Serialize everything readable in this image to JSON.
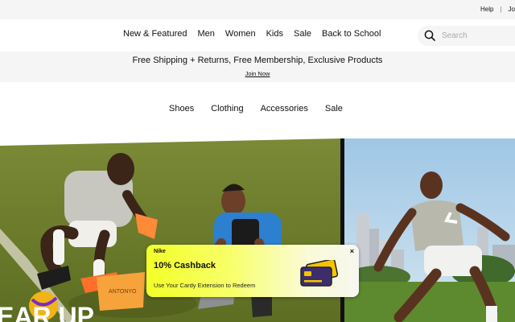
{
  "topbar": {
    "help": "Help",
    "separator": "|",
    "join": "Jo"
  },
  "nav": {
    "items": [
      "New & Featured",
      "Men",
      "Women",
      "Kids",
      "Sale",
      "Back to School"
    ],
    "search_placeholder": "Search"
  },
  "promo": {
    "message": "Free Shipping + Returns, Free Membership, Exclusive Products",
    "link": "Join Now"
  },
  "subnav": {
    "items": [
      "Shoes",
      "Clothing",
      "Accessories",
      "Sale"
    ]
  },
  "hero": {
    "headline_fragment": "EAR UP",
    "bag_print": "ANTONYO"
  },
  "popup": {
    "brand": "Nike",
    "close": "×",
    "title": "10% Cashback",
    "subtitle": "Use Your Cardy Extension to Redeem"
  },
  "colors": {
    "popup_accent": "#f3ff28",
    "card_purple": "#3d2e6b",
    "turf_green": "#6f7f2c"
  }
}
